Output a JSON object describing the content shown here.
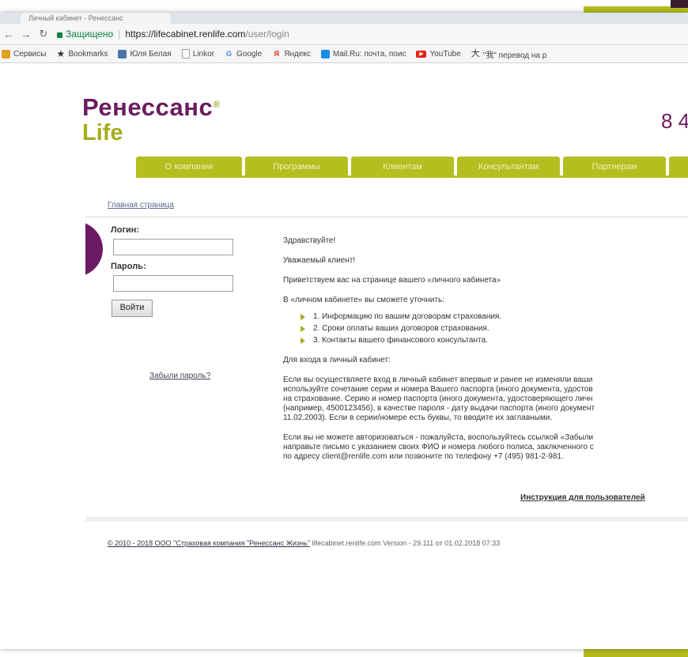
{
  "browser": {
    "tab_title": "Личный кабинет - Ренессанс",
    "secure_label": "Защищено",
    "url_host": "https://lifecabinet.renlife.com",
    "url_path": "/user/login"
  },
  "bookmarks": [
    {
      "label": "Сервисы",
      "icon": "apps-icon",
      "color": "#e0a020"
    },
    {
      "label": "Bookmarks",
      "icon": "star-icon",
      "color": "#333333"
    },
    {
      "label": "Юля Белая",
      "icon": "vk-icon",
      "color": "#4a76a8"
    },
    {
      "label": "Linkor",
      "icon": "page-icon",
      "color": "#999999"
    },
    {
      "label": "Google",
      "icon": "google-icon",
      "color": "#4285f4"
    },
    {
      "label": "Яндекс",
      "icon": "yandex-icon",
      "color": "#e52620"
    },
    {
      "label": "Mail.Ru: почта, поис",
      "icon": "mailru-icon",
      "color": "#168de2"
    },
    {
      "label": "YouTube",
      "icon": "youtube-icon",
      "color": "#e62117"
    },
    {
      "label": "\"我\" перевод на р",
      "icon": "dictionary-icon",
      "color": "#333333"
    }
  ],
  "site": {
    "logo_line1": "Ренессанс",
    "logo_reg": "®",
    "logo_line2": "Life",
    "phone": "8 4",
    "menu": [
      "О компании",
      "Программы",
      "Клиентам",
      "Консультантам",
      "Партнерам",
      ""
    ],
    "breadcrumb": "Главная страница"
  },
  "login": {
    "login_label": "Логин:",
    "password_label": "Пароль:",
    "submit_label": "Войти",
    "forgot_label": "Забыли пароль?"
  },
  "content": {
    "greeting": "Здравствуйте!",
    "dear": "Уважаемый клиент!",
    "welcome": "Приветствуем вас на странице вашего «личного кабинета»",
    "you_can": "В «личном кабинете» вы сможете уточнить:",
    "items": [
      "1. Информацию по вашим договорам страхования.",
      "2. Сроки оплаты ваших договоров страхования.",
      "3. Контакты вашего финансового консультанта."
    ],
    "enter_title": "Для входа в личный кабинет:",
    "para1_lines": [
      "Если вы осуществляете вход в личный кабинет впервые и ранее не изменяли ваши",
      "используйте сочетание серии и номера Вашего паспорта (иного документа, удостов",
      "на страхование. Серию и номер паспорта (иного документа, удостоверяющего личн",
      "(например, 4500123456), в качестве пароля - дату выдачи паспорта (иного документ",
      "11.02.2003). Если в серии/номере есть буквы, то вводите их заглавными."
    ],
    "para2_lines": [
      "Если вы не можете авторизоваться - пожалуйста, воспользуйтесь ссылкой «Забыли",
      "направьте письмо с указанием своих ФИО и номера любого полиса, заключенного с",
      "по адресу client@renlife.com или позвоните по телефону +7 (495) 981-2-981."
    ],
    "instructions_link": "Инструкция для пользователей"
  },
  "footer": {
    "copyright_link": "© 2010 - 2018 ООО \"Страховая компания \"Ренессанс Жизнь\"",
    "rest": " lifecabinet.renlife.com Version - 29.111 от 01.02.2018 07:33"
  }
}
